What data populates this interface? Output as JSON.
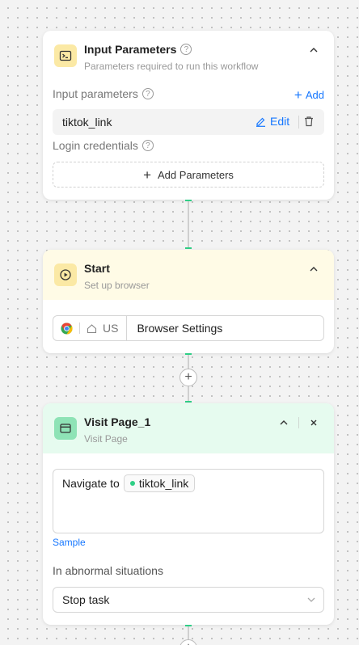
{
  "input_card": {
    "title": "Input Parameters",
    "subtitle": "Parameters required to run this workflow",
    "input_params_label": "Input parameters",
    "add_label": "Add",
    "param_name": "tiktok_link",
    "edit_label": "Edit",
    "login_label": "Login credentials",
    "add_params_label": "Add Parameters"
  },
  "start_card": {
    "title": "Start",
    "subtitle": "Set up browser",
    "region": "US",
    "browser_settings": "Browser Settings"
  },
  "visit_card": {
    "title": "Visit Page_1",
    "subtitle": "Visit Page",
    "navigate_text": "Navigate to",
    "var_chip": "tiktok_link",
    "sample_label": "Sample",
    "abnormal_label": "In abnormal situations",
    "select_value": "Stop task"
  },
  "colors": {
    "accent": "#1677ff",
    "input_icon_bg": "#fbe9a5",
    "start_header_bg": "#fffbe6",
    "visit_header_bg": "#e6fbef",
    "visit_icon_bg": "#8ee3b6",
    "connector_green": "#2fcf86"
  }
}
